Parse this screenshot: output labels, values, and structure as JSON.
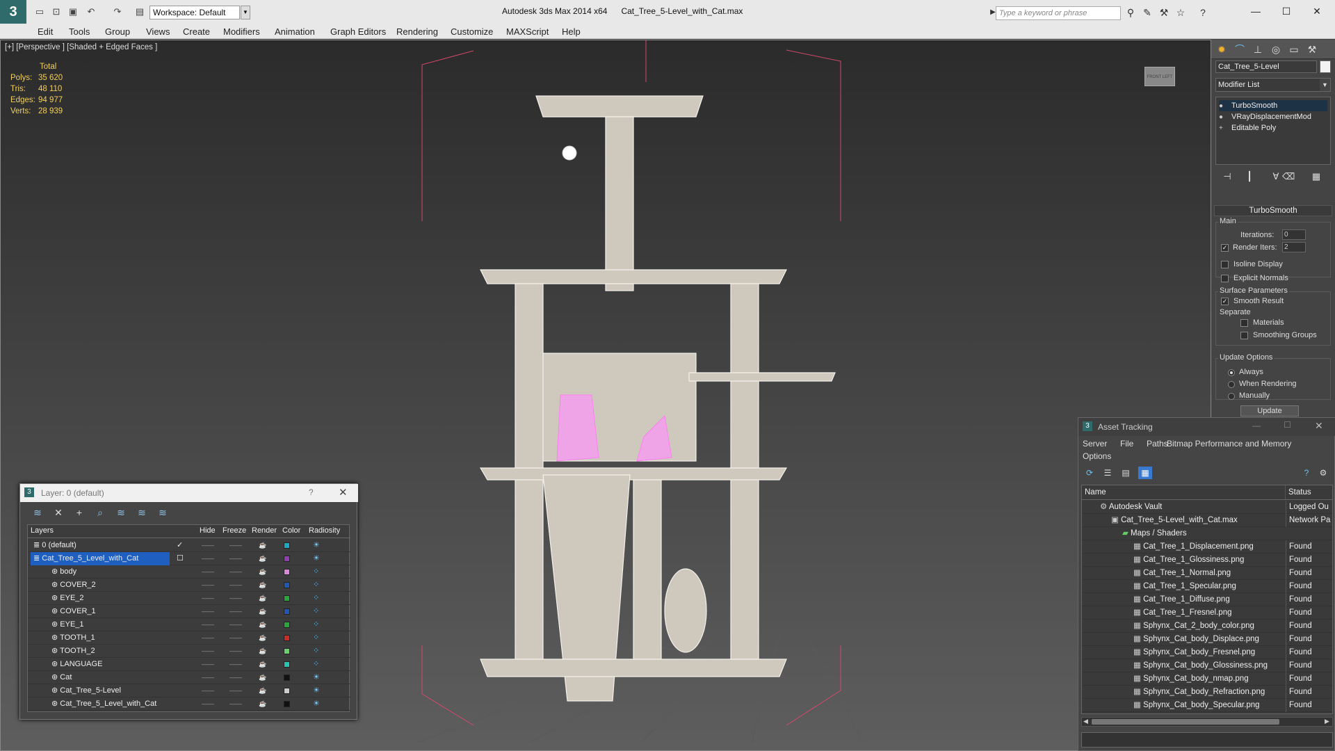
{
  "titlebar": {
    "app_title": "Autodesk 3ds Max  2014 x64",
    "file_title": "Cat_Tree_5-Level_with_Cat.max",
    "workspace": "Workspace: Default",
    "search_placeholder": "Type a keyword or phrase"
  },
  "menu": [
    "Edit",
    "Tools",
    "Group",
    "Views",
    "Create",
    "Modifiers",
    "Animation",
    "Graph Editors",
    "Rendering",
    "Customize",
    "MAXScript",
    "Help"
  ],
  "viewport": {
    "label": "[+] [Perspective ] [Shaded + Edged Faces ]",
    "stats_header": "Total",
    "stats": [
      {
        "k": "Polys:",
        "v": "35 620"
      },
      {
        "k": "Tris:",
        "v": "48 110"
      },
      {
        "k": "Edges:",
        "v": "94 977"
      },
      {
        "k": "Verts:",
        "v": "28 939"
      }
    ],
    "viewcube_label": "FRONT   LEFT"
  },
  "command_panel": {
    "object_name": "Cat_Tree_5-Level",
    "modifier_list": "Modifier List",
    "stack": [
      "TurboSmooth",
      "VRayDisplacementMod",
      "Editable Poly"
    ],
    "rollout": "TurboSmooth",
    "main": "Main",
    "iterations_label": "Iterations:",
    "iterations_value": "0",
    "render_iters_label": "Render Iters:",
    "render_iters_value": "2",
    "isoline": "Isoline Display",
    "explicit_normals": "Explicit Normals",
    "surface_params": "Surface Parameters",
    "smooth_result": "Smooth Result",
    "separate": "Separate",
    "materials": "Materials",
    "smoothing_groups": "Smoothing Groups",
    "update_options": "Update Options",
    "always": "Always",
    "when_rendering": "When Rendering",
    "manually": "Manually",
    "update_btn": "Update"
  },
  "layer_dialog": {
    "title": "Layer: 0 (default)",
    "help": "?",
    "columns": [
      "Layers",
      "Hide",
      "Freeze",
      "Render",
      "Color",
      "Radiosity"
    ],
    "rows": [
      {
        "name": "0 (default)",
        "indent": 1,
        "color": "#1fa6c2",
        "current": true
      },
      {
        "name": "Cat_Tree_5_Level_with_Cat",
        "indent": 1,
        "color": "#8e3fb0",
        "selected": true
      },
      {
        "name": "body",
        "indent": 2,
        "color": "#d88ad8"
      },
      {
        "name": "COVER_2",
        "indent": 2,
        "color": "#2356b0"
      },
      {
        "name": "EYE_2",
        "indent": 2,
        "color": "#2aa53c"
      },
      {
        "name": "COVER_1",
        "indent": 2,
        "color": "#2356b0"
      },
      {
        "name": "EYE_1",
        "indent": 2,
        "color": "#2aa53c"
      },
      {
        "name": "TOOTH_1",
        "indent": 2,
        "color": "#c92a2a"
      },
      {
        "name": "TOOTH_2",
        "indent": 2,
        "color": "#6cd06c"
      },
      {
        "name": "LANGUAGE",
        "indent": 2,
        "color": "#2ac2b0"
      },
      {
        "name": "Cat",
        "indent": 2,
        "color": "#111111"
      },
      {
        "name": "Cat_Tree_5-Level",
        "indent": 2,
        "color": "#cccccc"
      },
      {
        "name": "Cat_Tree_5_Level_with_Cat",
        "indent": 2,
        "color": "#111111"
      }
    ]
  },
  "asset_tracking": {
    "title": "Asset Tracking",
    "menu": [
      "Server",
      "File",
      "Paths",
      "Bitmap Performance and Memory",
      "Options"
    ],
    "columns": [
      "Name",
      "Status"
    ],
    "rows": [
      {
        "name": "Autodesk Vault",
        "indent": 1,
        "status": "Logged Ou"
      },
      {
        "name": "Cat_Tree_5-Level_with_Cat.max",
        "indent": 2,
        "status": "Network Pa"
      },
      {
        "name": "Maps / Shaders",
        "indent": 3,
        "status": ""
      },
      {
        "name": "Cat_Tree_1_Displacement.png",
        "indent": 4,
        "status": "Found"
      },
      {
        "name": "Cat_Tree_1_Glossiness.png",
        "indent": 4,
        "status": "Found"
      },
      {
        "name": "Cat_Tree_1_Normal.png",
        "indent": 4,
        "status": "Found"
      },
      {
        "name": "Cat_Tree_1_Specular.png",
        "indent": 4,
        "status": "Found"
      },
      {
        "name": "Cat_Tree_1_Diffuse.png",
        "indent": 4,
        "status": "Found"
      },
      {
        "name": "Cat_Tree_1_Fresnel.png",
        "indent": 4,
        "status": "Found"
      },
      {
        "name": "Sphynx_Cat_2_body_color.png",
        "indent": 4,
        "status": "Found"
      },
      {
        "name": "Sphynx_Cat_body_Displace.png",
        "indent": 4,
        "status": "Found"
      },
      {
        "name": "Sphynx_Cat_body_Fresnel.png",
        "indent": 4,
        "status": "Found"
      },
      {
        "name": "Sphynx_Cat_body_Glossiness.png",
        "indent": 4,
        "status": "Found"
      },
      {
        "name": "Sphynx_Cat_body_nmap.png",
        "indent": 4,
        "status": "Found"
      },
      {
        "name": "Sphynx_Cat_body_Refraction.png",
        "indent": 4,
        "status": "Found"
      },
      {
        "name": "Sphynx_Cat_body_Specular.png",
        "indent": 4,
        "status": "Found"
      }
    ]
  }
}
